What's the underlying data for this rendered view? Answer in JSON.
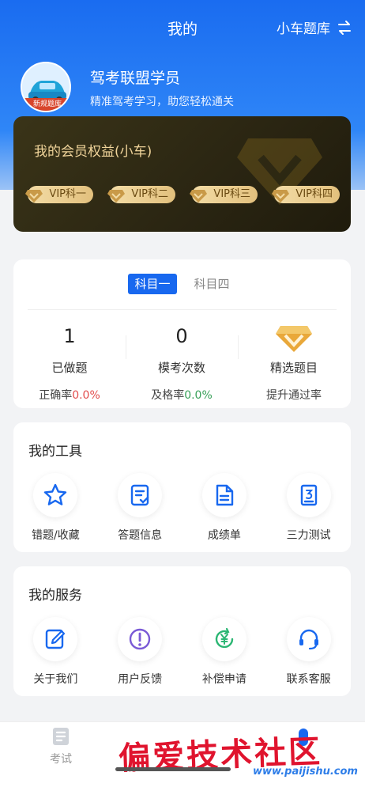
{
  "header": {
    "title": "我的",
    "question_bank": "小车题库"
  },
  "profile": {
    "name": "驾考联盟学员",
    "subtitle": "精准驾考学习，助您轻松通关",
    "avatar_badge": "新规题库"
  },
  "vip": {
    "title": "我的会员权益(小车)",
    "chips": [
      "VIP科一",
      "VIP科二",
      "VIP科三",
      "VIP科四"
    ],
    "accent": "#f0d49a"
  },
  "stats": {
    "tabs": [
      {
        "label": "科目一",
        "active": true
      },
      {
        "label": "科目四",
        "active": false
      }
    ],
    "done": {
      "value": "1",
      "label": "已做题",
      "foot_label": "正确率",
      "foot_value": "0.0%"
    },
    "mock": {
      "value": "0",
      "label": "模考次数",
      "foot_label": "及格率",
      "foot_value": "0.0%"
    },
    "selected": {
      "label": "精选题目",
      "foot_label": "提升通过率"
    }
  },
  "tools": {
    "title": "我的工具",
    "items": [
      {
        "label": "错题/收藏",
        "icon": "star-icon"
      },
      {
        "label": "答题信息",
        "icon": "answer-info-icon"
      },
      {
        "label": "成绩单",
        "icon": "report-icon"
      },
      {
        "label": "三力测试",
        "icon": "three-ability-icon"
      }
    ]
  },
  "services": {
    "title": "我的服务",
    "items": [
      {
        "label": "关于我们",
        "icon": "edit-icon"
      },
      {
        "label": "用户反馈",
        "icon": "feedback-icon"
      },
      {
        "label": "补偿申请",
        "icon": "compensation-icon"
      },
      {
        "label": "联系客服",
        "icon": "headset-icon"
      }
    ]
  },
  "tabbar": {
    "exam": "考试"
  },
  "watermark": {
    "text": "偏爱技术社区",
    "url": "www.paijishu.com"
  },
  "colors": {
    "primary": "#1868ef",
    "red": "#e24d4d",
    "green": "#3aa15a"
  }
}
